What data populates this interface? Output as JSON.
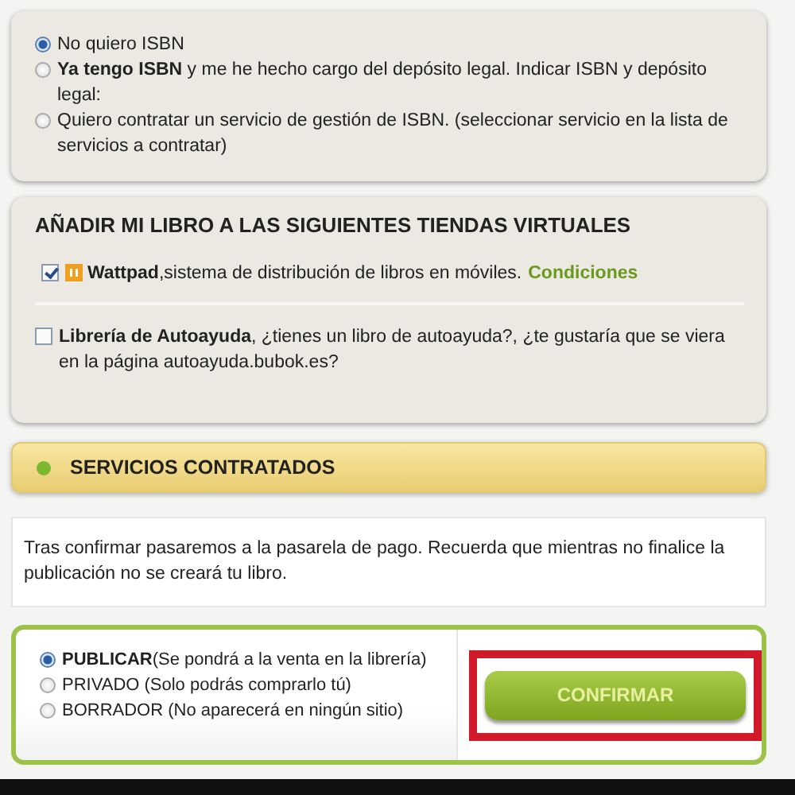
{
  "isbn_options": [
    {
      "label": "No quiero ISBN",
      "selected": true
    },
    {
      "label": "**Ya tengo ISBN** y me he hecho cargo del depósito legal. Indicar ISBN y depósito legal:",
      "selected": false
    },
    {
      "label": "Quiero contratar un servicio de gestión de ISBN. (seleccionar servicio en la lista de servicios a contratar)",
      "selected": false
    }
  ],
  "stores": {
    "title": "AÑADIR MI LIBRO A LAS SIGUIENTES TIENDAS VIRTUALES",
    "items": [
      {
        "text": "**Wattpad**,sistema de distribución de libros en móviles.",
        "checked": true,
        "has_logo": true,
        "link": "Condiciones"
      },
      {
        "text": "**Librería de Autoayuda**, ¿tienes un libro de autoayuda?, ¿te gustaría que se viera en la página autoayuda.bubok.es?",
        "checked": false,
        "has_logo": false
      }
    ]
  },
  "services_header": {
    "title": "SERVICIOS CONTRATADOS",
    "color": "#7cb82f"
  },
  "note": "Tras confirmar pasaremos a la pasarela de pago. Recuerda que mientras no finalice la publicación no se creará tu libro.",
  "publish_options": [
    {
      "label": "**PUBLICAR**(Se pondrá a la venta en la librería)",
      "selected": true
    },
    {
      "label": "PRIVADO (Solo podrás comprarlo tú)",
      "selected": false
    },
    {
      "label": "BORRADOR (No aparecerá en ningún sitio)",
      "selected": false
    }
  ],
  "confirm_button": {
    "label": "CONFIRMAR",
    "highlighted": true
  }
}
